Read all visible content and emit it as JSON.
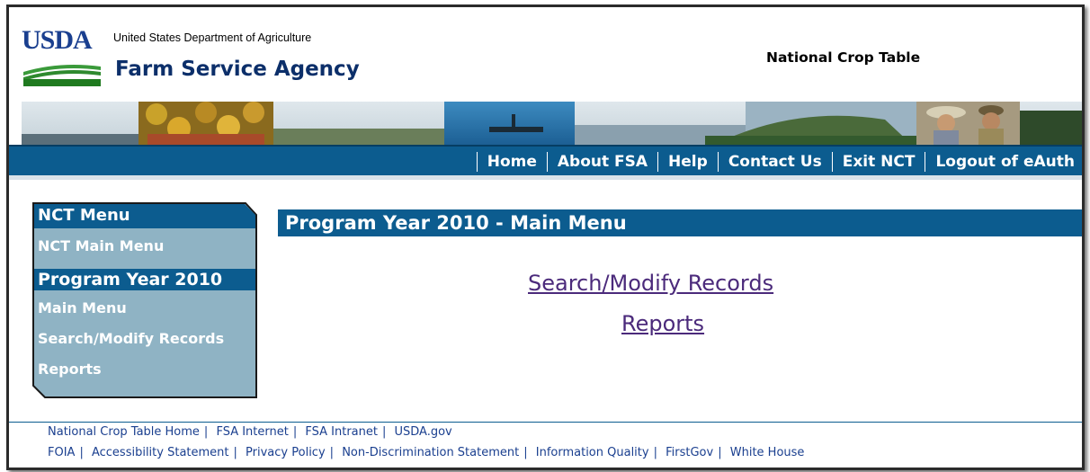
{
  "header": {
    "logo_text": "USDA",
    "department": "United States Department of Agriculture",
    "agency": "Farm Service Agency",
    "app_title": "National Crop Table"
  },
  "nav": {
    "links": [
      "Home",
      "About FSA",
      "Help",
      "Contact Us",
      "Exit NCT",
      "Logout of eAuth"
    ]
  },
  "sidebar": {
    "section1_title": "NCT Menu",
    "section1_items": [
      "NCT Main Menu"
    ],
    "section2_title": "Program Year 2010",
    "section2_items": [
      "Main Menu",
      "Search/Modify Records",
      "Reports"
    ]
  },
  "main": {
    "title": "Program Year 2010 - Main Menu",
    "links": [
      "Search/Modify Records",
      "Reports"
    ]
  },
  "footer": {
    "row1": [
      "National Crop Table Home",
      "FSA Internet",
      "FSA Intranet",
      "USDA.gov"
    ],
    "row2": [
      "FOIA",
      "Accessibility Statement",
      "Privacy Policy",
      "Non-Discrimination Statement",
      "Information Quality",
      "FirstGov",
      "White House"
    ]
  },
  "colors": {
    "nav_blue": "#0c5c8f",
    "sidebar_light": "#8fb3c4",
    "link_purple": "#4b2a7b",
    "footer_blue": "#1a3f8f"
  }
}
